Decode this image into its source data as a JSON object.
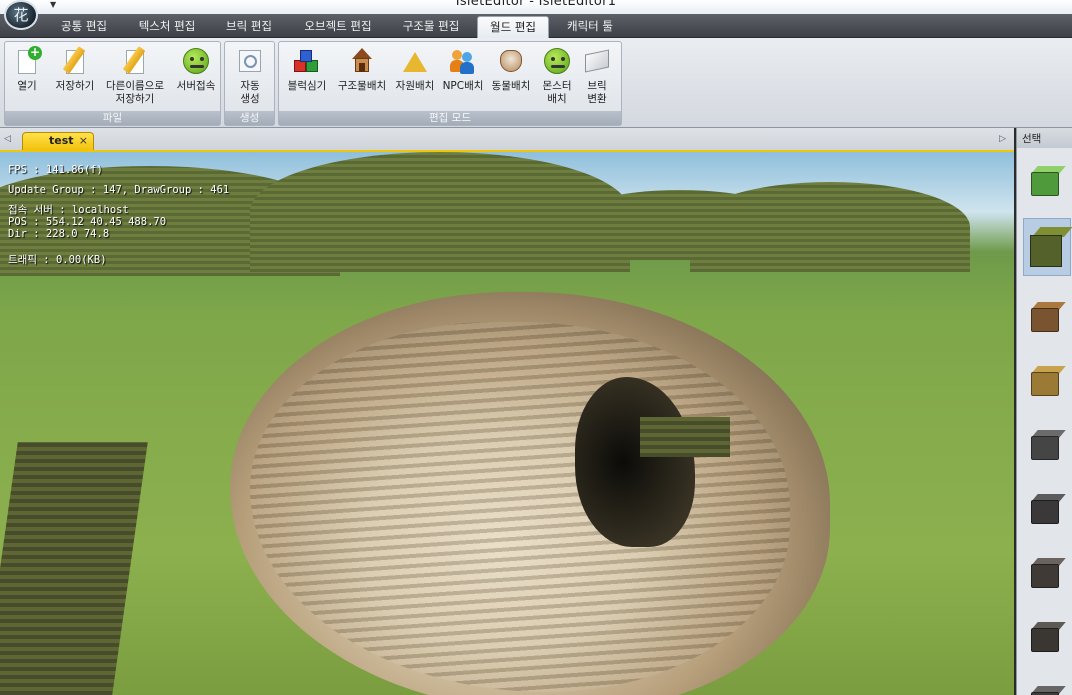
{
  "window": {
    "title": "IsletEditor - IsletEditor1",
    "app_icon_glyph": "花"
  },
  "tabs": [
    {
      "label": "공통 편집"
    },
    {
      "label": "텍스처 편집"
    },
    {
      "label": "브릭 편집"
    },
    {
      "label": "오브젝트 편집"
    },
    {
      "label": "구조물 편집"
    },
    {
      "label": "월드 편집",
      "active": true
    },
    {
      "label": "캐릭터 툴"
    }
  ],
  "ribbon": {
    "groups": [
      {
        "label": "파일",
        "buttons": [
          {
            "label": "열기",
            "icon": "open-file-icon"
          },
          {
            "label": "저장하기",
            "icon": "save-pencil-icon"
          },
          {
            "label": "다른이름으로\n저장하기",
            "icon": "save-as-pencil-icon"
          },
          {
            "label": "서버접속",
            "icon": "server-face-icon"
          }
        ]
      },
      {
        "label": "생성",
        "buttons": [
          {
            "label": "자동\n생성",
            "icon": "auto-generate-icon"
          }
        ]
      },
      {
        "label": "편집 모드",
        "buttons": [
          {
            "label": "블럭심기",
            "icon": "block-cubes-icon"
          },
          {
            "label": "구조물배치",
            "icon": "structure-house-icon"
          },
          {
            "label": "자원배치",
            "icon": "resource-pyramid-icon"
          },
          {
            "label": "NPC배치",
            "icon": "npc-people-icon"
          },
          {
            "label": "동물배치",
            "icon": "animal-icon"
          },
          {
            "label": "몬스터\n배치",
            "icon": "monster-face-icon"
          },
          {
            "label": "브릭\n변환",
            "icon": "brick-convert-icon"
          }
        ]
      }
    ]
  },
  "document": {
    "tab_label": "test",
    "close_glyph": "×",
    "scroll_left": "◁",
    "scroll_right": "▷"
  },
  "viewport": {
    "stats": [
      "FPS : 141.86(f)",
      "Update Group : 147, DrawGroup : 461",
      "접속 서버 : localhost",
      "POS : 554.12 40.45 488.70",
      "Dir : 228.0 74.8",
      "",
      "트래픽 : 0.00(KB)"
    ]
  },
  "palette": {
    "header": "선택",
    "items": [
      {
        "name": "grass-block",
        "top": "#8fd06a",
        "face": "#4f9a3a"
      },
      {
        "name": "moss-block",
        "top": "#7f8f34",
        "face": "#55612a",
        "selected": true
      },
      {
        "name": "dirt-block",
        "top": "#a9793f",
        "face": "#7a5430"
      },
      {
        "name": "sand-block",
        "top": "#c9a24d",
        "face": "#9a7a35"
      },
      {
        "name": "stone-block",
        "top": "#6b6b6b",
        "face": "#454545"
      },
      {
        "name": "dark-stone-block",
        "top": "#5c5c5c",
        "face": "#3a3838"
      },
      {
        "name": "gravel-block",
        "top": "#6a6360",
        "face": "#403a36"
      },
      {
        "name": "coal-block",
        "top": "#5d5a55",
        "face": "#3a3733"
      },
      {
        "name": "rock-block",
        "top": "#686664",
        "face": "#3f3d3b"
      }
    ]
  }
}
